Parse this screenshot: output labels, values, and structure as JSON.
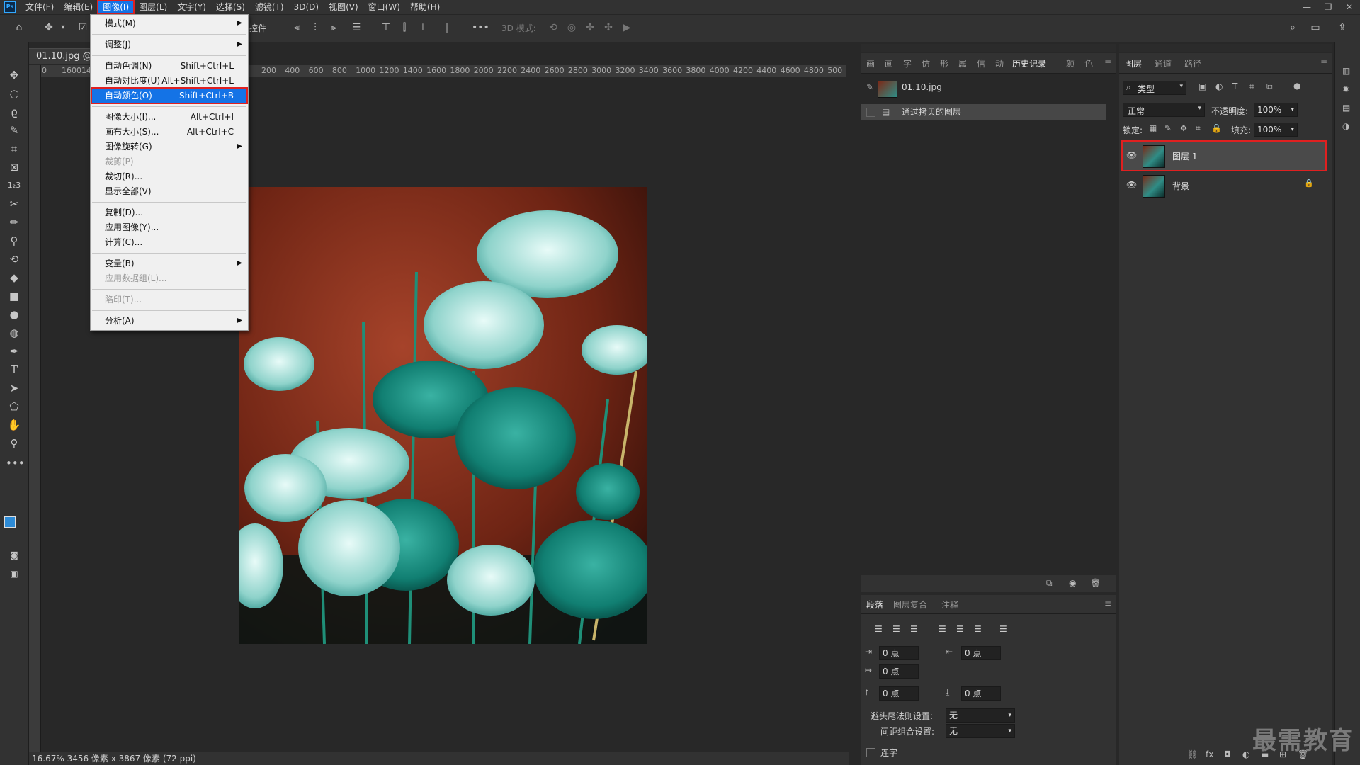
{
  "app": {
    "logo": "Ps"
  },
  "menubar": {
    "items": [
      "文件(F)",
      "编辑(E)",
      "图像(I)",
      "图层(L)",
      "文字(Y)",
      "选择(S)",
      "滤镜(T)",
      "3D(D)",
      "视图(V)",
      "窗口(W)",
      "帮助(H)"
    ],
    "active_index": 2
  },
  "window_controls": [
    "—",
    "❐",
    "✕"
  ],
  "options_bar": {
    "controls_label": "控件",
    "mode_3d_label": "3D 模式:"
  },
  "document": {
    "tab_title": "01.10.jpg @ 1",
    "status_text": "16.67% 3456 像素 x 3867 像素 (72 ppi)",
    "ruler_ticks_left": [
      "0",
      "1600",
      "140"
    ],
    "ruler_ticks": [
      "200",
      "400",
      "600",
      "800",
      "1000",
      "1200",
      "1400",
      "1600",
      "1800",
      "2000",
      "2200",
      "2400",
      "2600",
      "2800",
      "3000",
      "3200",
      "3400",
      "3600",
      "3800",
      "4000",
      "4200",
      "4400",
      "4600",
      "4800",
      "500"
    ]
  },
  "image_menu": {
    "items": [
      {
        "label": "模式(M)",
        "shortcut": "",
        "submenu": true,
        "disabled": false
      },
      {
        "sep": true
      },
      {
        "label": "调整(J)",
        "shortcut": "",
        "submenu": true,
        "disabled": false
      },
      {
        "sep": true
      },
      {
        "label": "自动色调(N)",
        "shortcut": "Shift+Ctrl+L",
        "submenu": false,
        "disabled": false
      },
      {
        "label": "自动对比度(U)",
        "shortcut": "Alt+Shift+Ctrl+L",
        "submenu": false,
        "disabled": false
      },
      {
        "label": "自动颜色(O)",
        "shortcut": "Shift+Ctrl+B",
        "submenu": false,
        "disabled": false,
        "highlighted": true
      },
      {
        "sep": true
      },
      {
        "label": "图像大小(I)...",
        "shortcut": "Alt+Ctrl+I",
        "submenu": false,
        "disabled": false
      },
      {
        "label": "画布大小(S)...",
        "shortcut": "Alt+Ctrl+C",
        "submenu": false,
        "disabled": false
      },
      {
        "label": "图像旋转(G)",
        "shortcut": "",
        "submenu": true,
        "disabled": false
      },
      {
        "label": "裁剪(P)",
        "shortcut": "",
        "submenu": false,
        "disabled": true
      },
      {
        "label": "裁切(R)...",
        "shortcut": "",
        "submenu": false,
        "disabled": false
      },
      {
        "label": "显示全部(V)",
        "shortcut": "",
        "submenu": false,
        "disabled": false
      },
      {
        "sep": true
      },
      {
        "label": "复制(D)...",
        "shortcut": "",
        "submenu": false,
        "disabled": false
      },
      {
        "label": "应用图像(Y)...",
        "shortcut": "",
        "submenu": false,
        "disabled": false
      },
      {
        "label": "计算(C)...",
        "shortcut": "",
        "submenu": false,
        "disabled": false
      },
      {
        "sep": true
      },
      {
        "label": "变量(B)",
        "shortcut": "",
        "submenu": true,
        "disabled": false
      },
      {
        "label": "应用数据组(L)...",
        "shortcut": "",
        "submenu": false,
        "disabled": true
      },
      {
        "sep": true
      },
      {
        "label": "陷印(T)...",
        "shortcut": "",
        "submenu": false,
        "disabled": true
      },
      {
        "sep": true
      },
      {
        "label": "分析(A)",
        "shortcut": "",
        "submenu": true,
        "disabled": false
      }
    ]
  },
  "history_panel": {
    "tabs": [
      "画",
      "画",
      "字",
      "仿",
      "形",
      "属",
      "信",
      "动",
      "历史记录",
      "颜",
      "色"
    ],
    "active_tab": "历史记录",
    "snapshot_name": "01.10.jpg",
    "steps": [
      "通过拷贝的图层"
    ]
  },
  "paragraph_panel": {
    "tabs": [
      "段落",
      "图层复合",
      "注释"
    ],
    "indent_left": "0 点",
    "indent_right": "0 点",
    "indent_first": "0 点",
    "space_before": "0 点",
    "space_after": "0 点",
    "hyphenation_label": "避头尾法则设置:",
    "hyphenation_value": "无",
    "spacing_label": "间距组合设置:",
    "spacing_value": "无",
    "ligature_label": "连字"
  },
  "layers_panel": {
    "tabs": [
      "图层",
      "通道",
      "路径"
    ],
    "filter_label": "类型",
    "blend_mode": "正常",
    "opacity_label": "不透明度:",
    "opacity_value": "100%",
    "lock_label": "锁定:",
    "fill_label": "填充:",
    "fill_value": "100%",
    "layers": [
      {
        "name": "图层 1",
        "selected": true,
        "locked": false
      },
      {
        "name": "背景",
        "selected": false,
        "locked": true
      }
    ]
  },
  "watermark": "最需教育",
  "colors": {
    "accent": "#1473e6",
    "highlight_box": "#e02020",
    "fg_swatch": "#2d8bd6",
    "bg_swatch": "#ffffff"
  }
}
